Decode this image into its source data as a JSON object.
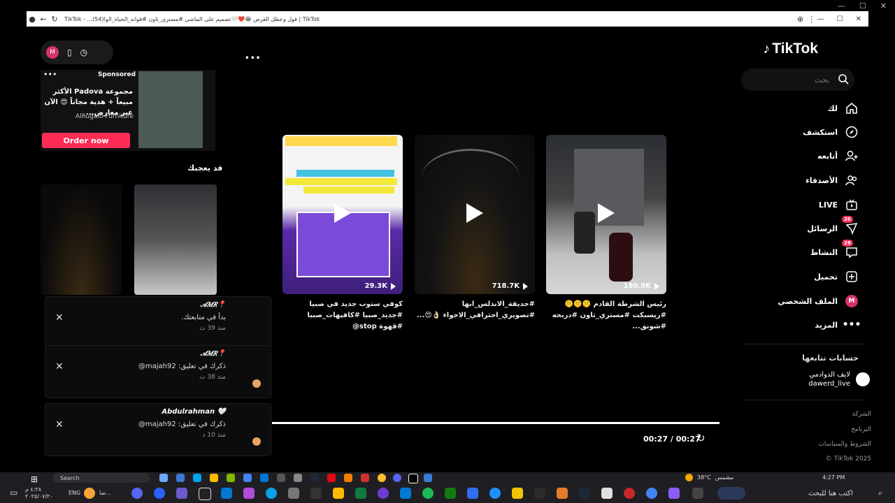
{
  "window": {
    "title": "TikTok - ...فول وعطل القرص 😂❤️🤍تصميم على الماشي #مستري_تاون #قواند_الحياة_الوا(54) | TikTok",
    "controls": [
      "—",
      "☐",
      "✕"
    ],
    "outer_controls": [
      "—",
      "☐",
      "✕"
    ]
  },
  "brand": {
    "name": "TikTok"
  },
  "search": {
    "placeholder": "بحث"
  },
  "nav": {
    "items": [
      {
        "label": "لك",
        "icon": "home-icon"
      },
      {
        "label": "استكشف",
        "icon": "compass-icon"
      },
      {
        "label": "أتابعه",
        "icon": "user-plus-icon"
      },
      {
        "label": "الأصدقاء",
        "icon": "friends-icon"
      },
      {
        "label": "LIVE",
        "icon": "live-icon"
      },
      {
        "label": "الرسائل",
        "icon": "send-icon",
        "badge": "26"
      },
      {
        "label": "النشاط",
        "icon": "activity-icon",
        "badge": "28"
      },
      {
        "label": "تحميل",
        "icon": "upload-icon"
      },
      {
        "label": "الملف الشخصي",
        "icon": "avatar",
        "avatar_letter": "M"
      },
      {
        "label": "المزيد",
        "icon": "more-icon"
      }
    ]
  },
  "following": {
    "title": "حسابات تتابعها",
    "accounts": [
      {
        "display": "لايف الدوادمي",
        "handle": "dawerd_live"
      }
    ]
  },
  "footer": {
    "links": [
      "الشركة",
      "البرنامج",
      "الشروط والسياسات"
    ],
    "copyright": "© TikTok 2025"
  },
  "videos": [
    {
      "views": "180.9K",
      "caption": "رئيس الشرطة القادم 🤫🤫🤫 #ريسبكت #مستري_تاون #دربحه #شونق..."
    },
    {
      "views": "718.7K",
      "caption": "#حديقة_الاندلس_ابها #تصويري_احترافي_الاجواء 👌🏻😍..."
    },
    {
      "views": "29.3K",
      "caption": "كوفي ستوب جديد في صبيا #جديد_صبيا #كافيهات_صبيا #قهوة stop@"
    }
  ],
  "mini": {
    "avatar_letter": "M",
    "more": "...",
    "sponsored_label": "Sponsored",
    "sponsored_text": "مجموعة Padova الأكثر مبيعاً + هدية مجاناً 😍 الآن عبر معارض...",
    "sponsor_name": "AlRugaib Furniture",
    "order_button": "Order now",
    "like_title": "قد يعجبك"
  },
  "notifications": [
    {
      "who": "𝒜𝑀𝑅📍",
      "msg": "بدأ في متابعتك.",
      "time": "منذ 39 ث"
    },
    {
      "who": "𝒜𝑀𝑅📍",
      "msg": "ذكرك في تعليق: majah92@",
      "time": "منذ 38 ث"
    },
    {
      "who": "Abdulrahman 🤍",
      "msg": "ذكرك في تعليق: majah92@",
      "time": "منذ 10 د"
    }
  ],
  "player": {
    "time": "00:27 / 00:27"
  },
  "taskbar": {
    "search_placeholder": "Search",
    "weather": "38°C",
    "weather_text": "مشمس",
    "clock": "4:27 PM",
    "search_bottom": "اكتب هنا للبحث",
    "lang": "ENG",
    "date": "٢٠٢٥/٠٧/٢٠",
    "time2": "٤:٢٨ م",
    "pinned_label": "صا..."
  }
}
